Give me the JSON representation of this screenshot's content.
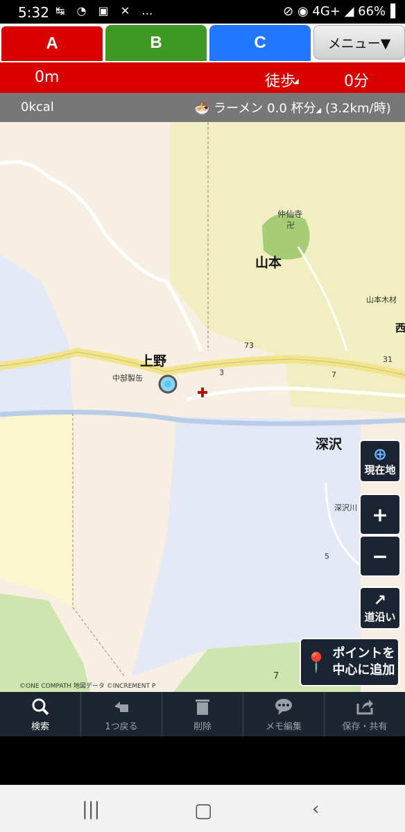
{
  "status": {
    "time": "5:32",
    "left_icons": "↹ ◔ ▣ ✕ …",
    "right": "⊘ ◉ 4G+ ◢ 66%▐"
  },
  "tabs": [
    {
      "label": "A"
    },
    {
      "label": "B"
    },
    {
      "label": "C"
    }
  ],
  "menu": {
    "label": "メニュー▼"
  },
  "route": {
    "distance": "0m",
    "mode": "徒歩",
    "duration": "0分"
  },
  "calorie": {
    "kcal": "0kcal",
    "food": "ラーメン 0.0 杯分",
    "speed": "(3.2km/時)"
  },
  "map": {
    "labels": [
      {
        "text": "上野"
      },
      {
        "text": "山本"
      },
      {
        "text": "深沢"
      },
      {
        "text": "仲仙寺"
      },
      {
        "text": "山本木材"
      },
      {
        "text": "中部製缶"
      },
      {
        "text": "深沢川"
      },
      {
        "text": "73"
      },
      {
        "text": "31"
      },
      {
        "text": "7"
      },
      {
        "text": "3"
      },
      {
        "text": "5"
      },
      {
        "text": "7"
      },
      {
        "text": "西"
      },
      {
        "text": "卍"
      }
    ],
    "copyright": "©ONE COMPATH 地図データ ©INCREMENT P"
  },
  "controls": {
    "current_location": "現在地",
    "zoom_in": "+",
    "zoom_out": "−",
    "along_road": "道沿い",
    "add_point_1": "ポイントを",
    "add_point_2": "中心に追加"
  },
  "toolbar": {
    "search": "検索",
    "back": "1つ戻る",
    "delete": "削除",
    "memo": "メモ編集",
    "save": "保存・共有"
  }
}
